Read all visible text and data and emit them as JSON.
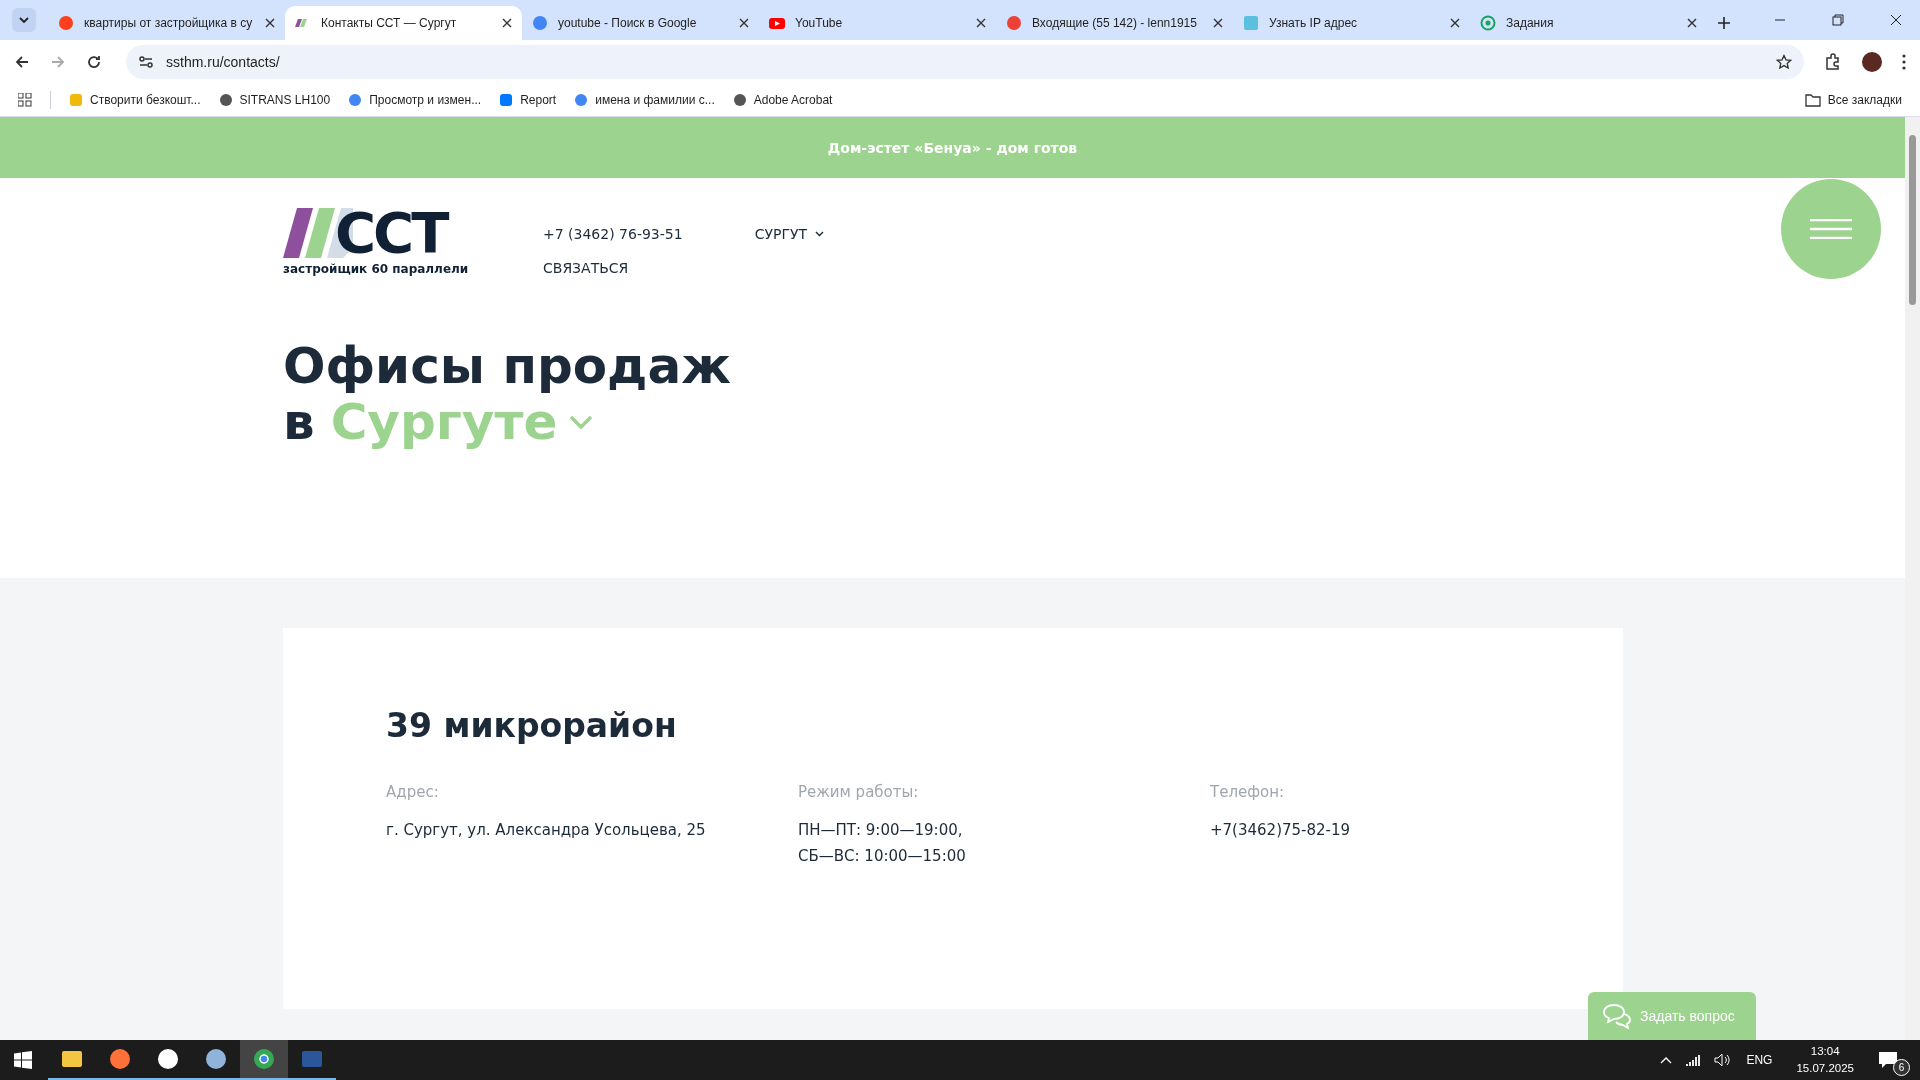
{
  "browser": {
    "tabs": [
      {
        "title": "квартиры от застройщика в су",
        "kind": "yandex",
        "selected": false
      },
      {
        "title": "Контакты ССТ — Сургут",
        "kind": "sst",
        "selected": true
      },
      {
        "title": "youtube - Поиск в Google",
        "kind": "google",
        "selected": false
      },
      {
        "title": "YouTube",
        "kind": "youtube",
        "selected": false
      },
      {
        "title": "Входящие (55 142) - lenn1915",
        "kind": "gmail",
        "selected": false
      },
      {
        "title": "Узнать IP адрес",
        "kind": "ip",
        "selected": false
      },
      {
        "title": "Задания",
        "kind": "target",
        "selected": false
      }
    ],
    "address": "ssthm.ru/contacts/",
    "bookmarks": [
      {
        "label": "Створити безкошт...",
        "kind": "diamond"
      },
      {
        "label": "SITRANS LH100",
        "kind": "globe"
      },
      {
        "label": "Просмотр и измен...",
        "kind": "google"
      },
      {
        "label": "Report",
        "kind": "vk"
      },
      {
        "label": "имена и фамилии с...",
        "kind": "google"
      },
      {
        "label": "Adobe Acrobat",
        "kind": "globe"
      }
    ],
    "all_bookmarks": "Все закладки"
  },
  "page": {
    "banner": "Дом-эстет «Бенуа» - дом готов",
    "logo": {
      "mark": "ССТ",
      "tagline": "застройщик 60 параллели"
    },
    "phone": "+7 (3462) 76-93-51",
    "contact_link": "СВЯЗАТЬСЯ",
    "city": "СУРГУТ",
    "heading": {
      "line1": "Офисы продаж",
      "prefix": "в",
      "city": "Сургуте"
    },
    "office": {
      "title": "39 микрорайон",
      "columns": [
        {
          "label": "Адрес:",
          "lines": [
            "г. Сургут, ул. Александра Усольцева, 25"
          ]
        },
        {
          "label": "Режим работы:",
          "lines": [
            "ПН—ПТ: 9:00—19:00,",
            "СБ—ВС: 10:00—15:00"
          ]
        },
        {
          "label": "Телефон:",
          "lines": [
            "+7(3462)75-82-19"
          ]
        }
      ]
    },
    "chat_button": "Задать вопрос"
  },
  "taskbar": {
    "apps": [
      {
        "kind": "folder",
        "selected": false
      },
      {
        "kind": "firefox",
        "selected": false
      },
      {
        "kind": "yandex",
        "selected": false
      },
      {
        "kind": "paint",
        "selected": false
      },
      {
        "kind": "chrome",
        "selected": true
      },
      {
        "kind": "word",
        "selected": false
      }
    ],
    "language": "ENG",
    "time": "13:04",
    "date": "15.07.2025",
    "notifications": "6"
  }
}
